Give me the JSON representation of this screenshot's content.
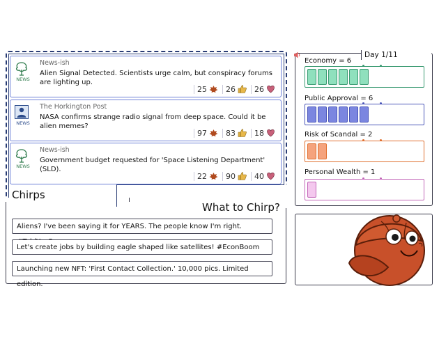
{
  "feed": {
    "title": "Chirps",
    "posts": [
      {
        "source": "News-ish",
        "logo_icon": "tree-news-logo-icon",
        "logo_label": "NEWS",
        "text": "Alien Signal Detected. Scientists urge calm, but conspiracy forums are lighting up.",
        "stats": [
          {
            "value": "25",
            "icon": "leaf-icon"
          },
          {
            "value": "26",
            "icon": "thumbs-up-icon"
          },
          {
            "value": "26",
            "icon": "heart-icon"
          }
        ]
      },
      {
        "source": "The Horkington Post",
        "logo_icon": "person-news-logo-icon",
        "logo_label": "NEWS",
        "text": "NASA confirms strange radio signal from deep space. Could it be alien memes?",
        "stats": [
          {
            "value": "97",
            "icon": "leaf-icon"
          },
          {
            "value": "83",
            "icon": "thumbs-up-icon"
          },
          {
            "value": "18",
            "icon": "heart-icon"
          }
        ]
      },
      {
        "source": "News-ish",
        "logo_icon": "tree-news-logo-icon",
        "logo_label": "NEWS",
        "text": "Government budget requested for 'Space Listening Department' (SLD).",
        "stats": [
          {
            "value": "22",
            "icon": "leaf-icon"
          },
          {
            "value": "90",
            "icon": "thumbs-up-icon"
          },
          {
            "value": "40",
            "icon": "heart-icon"
          }
        ]
      }
    ]
  },
  "compose": {
    "title": "What to Chirp?",
    "options": [
      "Aliens? I've been saying it for YEARS. The people know I'm right. #ToldYouSo",
      "Let's create jobs by building eagle shaped like satellites! #EconBoom",
      "Launching new NFT: 'First Contact Collection.' 10,000 pics. Limited edition."
    ]
  },
  "status": {
    "day_label": "Day 1/11",
    "sound_icon": "speaker-icon",
    "meters": [
      {
        "label": "Economy = 6",
        "value": 6,
        "max": 11,
        "color": "#8fe0bd",
        "border": "#3a9a72"
      },
      {
        "label": "Public Approval = 6",
        "value": 6,
        "max": 11,
        "color": "#7b86e0",
        "border": "#4a56b8"
      },
      {
        "label": "Risk of Scandal = 2",
        "value": 2,
        "max": 11,
        "color": "#f5a37d",
        "border": "#e07030"
      },
      {
        "label": "Personal Wealth = 1",
        "value": 1,
        "max": 11,
        "color": "#f4c8ee",
        "border": "#c266b8"
      }
    ]
  },
  "avatar": {
    "icon": "cap-mascot-avatar",
    "color": "#c8502a"
  }
}
